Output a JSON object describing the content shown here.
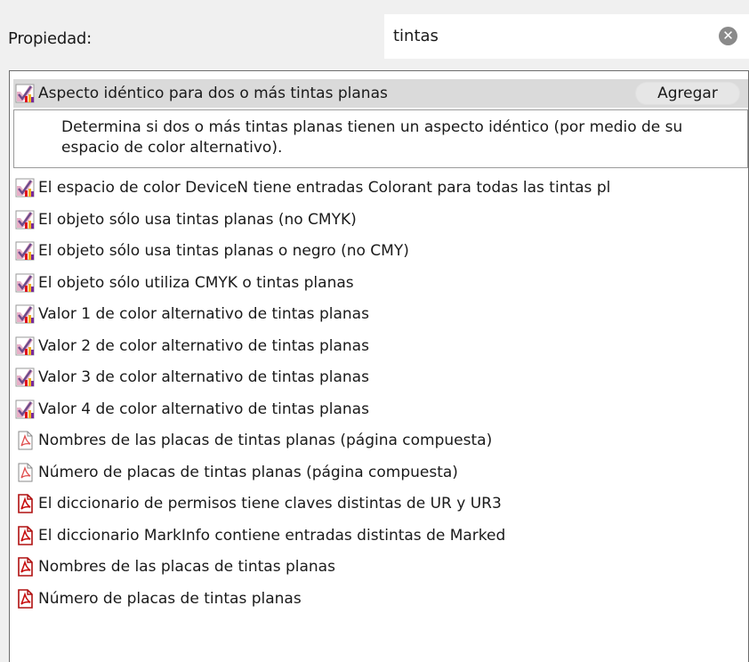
{
  "header": {
    "property_label": "Propiedad:",
    "search_value": "tintas",
    "clear_icon": "clear-circle-x-icon"
  },
  "selected": {
    "label": "Aspecto idéntico para dos o más tintas planas",
    "add_label": "Agregar",
    "description": "Determina si dos o más tintas planas tienen un aspecto idéntico (por medio de su espacio de color alternativo).",
    "icon": "preflight-check-icon"
  },
  "items": [
    {
      "label": "El espacio de color DeviceN tiene entradas Colorant para todas las tintas pl",
      "icon": "preflight-check-icon"
    },
    {
      "label": "El objeto sólo usa tintas planas (no CMYK)",
      "icon": "preflight-check-icon"
    },
    {
      "label": "El objeto sólo usa tintas planas o negro (no CMY)",
      "icon": "preflight-check-icon"
    },
    {
      "label": "El objeto sólo utiliza CMYK o tintas planas",
      "icon": "preflight-check-icon"
    },
    {
      "label": "Valor 1 de color alternativo de tintas planas",
      "icon": "preflight-check-icon"
    },
    {
      "label": "Valor 2 de color alternativo de tintas planas",
      "icon": "preflight-check-icon"
    },
    {
      "label": "Valor 3 de color alternativo de tintas planas",
      "icon": "preflight-check-icon"
    },
    {
      "label": "Valor 4 de color alternativo de tintas planas",
      "icon": "preflight-check-icon"
    },
    {
      "label": "Nombres de las placas de tintas planas (página compuesta)",
      "icon": "pdf-document-light-icon"
    },
    {
      "label": "Número de placas de tintas planas (página compuesta)",
      "icon": "pdf-document-light-icon"
    },
    {
      "label": "El diccionario de permisos tiene claves distintas de UR y UR3",
      "icon": "pdf-document-icon"
    },
    {
      "label": "El diccionario MarkInfo contiene entradas distintas de Marked",
      "icon": "pdf-document-icon"
    },
    {
      "label": "Nombres de las placas de tintas planas",
      "icon": "pdf-document-icon"
    },
    {
      "label": "Número de placas de tintas planas",
      "icon": "pdf-document-icon"
    }
  ]
}
